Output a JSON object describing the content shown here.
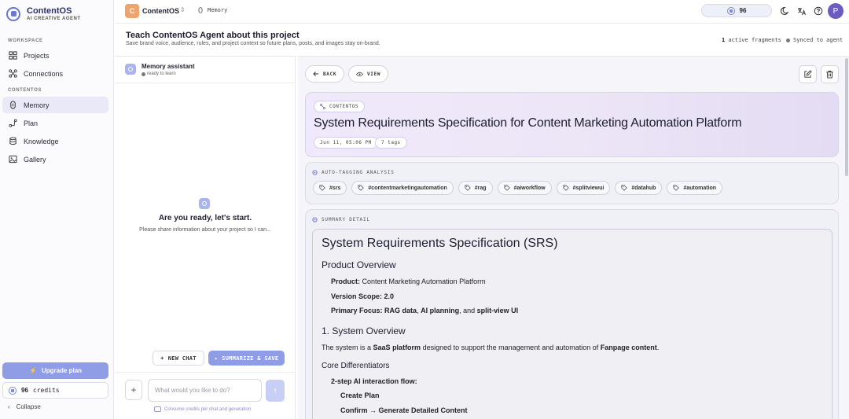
{
  "brand": {
    "name": "ContentOS",
    "tagline": "AI CREATIVE AGENT"
  },
  "sidebar": {
    "workspace_label": "WORKSPACE",
    "workspace_items": [
      {
        "label": "Projects",
        "icon": "grid-icon"
      },
      {
        "label": "Connections",
        "icon": "connections-icon"
      }
    ],
    "contentos_label": "CONTENTOS",
    "contentos_items": [
      {
        "label": "Memory",
        "icon": "memory-icon",
        "active": true
      },
      {
        "label": "Plan",
        "icon": "plan-icon"
      },
      {
        "label": "Knowledge",
        "icon": "database-icon"
      },
      {
        "label": "Gallery",
        "icon": "image-icon"
      }
    ],
    "upgrade_label": "Upgrade plan",
    "credits_value": "96",
    "credits_label": "credits",
    "collapse_label": "Collapse"
  },
  "topbar": {
    "project_initial": "C",
    "project_name": "ContentOS",
    "breadcrumb": "Memory",
    "credits": "96",
    "user_initial": "P"
  },
  "header": {
    "title": "Teach ContentOS Agent about this project",
    "subtitle": "Save brand voice, audience, rules, and project context so future plans, posts, and images stay on-brand.",
    "fragments_count": "1",
    "fragments_label": "active fragments",
    "synced_label": "Synced to agent"
  },
  "chat": {
    "title": "Memory assistant",
    "status": "ready to learn",
    "empty_title": "Are you ready, let's start.",
    "empty_subtitle": "Please share information about your project so I can...",
    "new_chat_label": "NEW CHAT",
    "summarize_label": "SUMMARIZE & SAVE",
    "input_placeholder": "What would you like to do?",
    "hint": "Consume credits per chat and generation"
  },
  "detail": {
    "back_label": "BACK",
    "view_label": "VIEW",
    "source_tag": "CONTENTOS",
    "title": "System Requirements Specification for Content Marketing Automation Platform",
    "date": "Jun 11, 05:06 PM",
    "tags_count": "7 tags",
    "autotag_label": "AUTO-TAGGING ANALYSIS",
    "tags": [
      "#srs",
      "#contentmarketingautomation",
      "#rag",
      "#aiworkflow",
      "#splitviewui",
      "#datahub",
      "#automation"
    ],
    "summary_label": "SUMMARY DETAIL",
    "doc": {
      "h1": "System Requirements Specification (SRS)",
      "product_overview": "Product Overview",
      "product_key": "Product:",
      "product_val": "Content Marketing Automation Platform",
      "version_key": "Version Scope:",
      "version_val": "2.0",
      "focus_key": "Primary Focus:",
      "focus_a": "RAG data",
      "focus_b": "AI planning",
      "focus_and": ", and",
      "focus_c": "split-view UI",
      "section1": "1. System Overview",
      "overview_pre": "The system is a",
      "overview_b1": "SaaS platform",
      "overview_mid": "designed to support the management and automation of",
      "overview_b2": "Fanpage content",
      "core": "Core Differentiators",
      "step_flow": "2-step AI interaction flow:",
      "create_plan": "Create Plan",
      "confirm": "Confirm → Generate Detailed Content"
    }
  }
}
